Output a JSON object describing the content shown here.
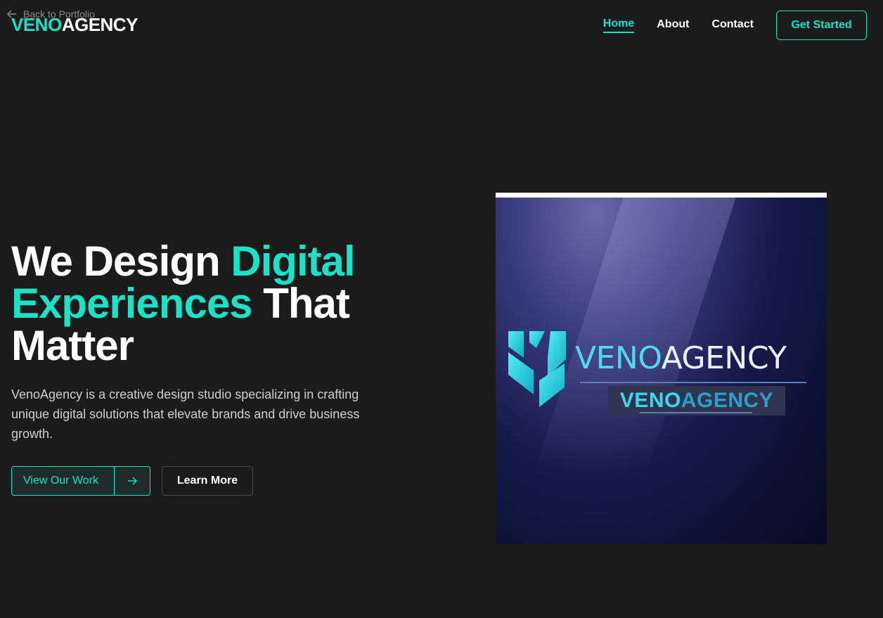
{
  "back_link": {
    "label": "Back to Portfolio",
    "icon": "arrow-left-icon"
  },
  "logo": {
    "accent": "VENO",
    "rest": "AGENCY"
  },
  "nav": {
    "items": [
      {
        "label": "Home",
        "active": true
      },
      {
        "label": "About",
        "active": false
      },
      {
        "label": "Contact",
        "active": false
      }
    ],
    "cta": "Get Started"
  },
  "hero": {
    "title_part1": "We Design ",
    "title_highlight": "Digital Experiences",
    "title_part2": " That Matter",
    "description": "VenoAgency is a creative design studio specializing in crafting unique digital solutions that elevate brands and drive business growth.",
    "primary_button": "View Our Work",
    "primary_button_icon": "arrow-right-icon",
    "secondary_button": "Learn More"
  },
  "hero_image": {
    "brand_accent": "VENO",
    "brand_rest": "AGENCY",
    "sub_accent": "VENO",
    "sub_rest": "AGENCY"
  },
  "colors": {
    "accent": "#1de0c4",
    "background": "#1b1b1b",
    "text": "#ffffff"
  }
}
